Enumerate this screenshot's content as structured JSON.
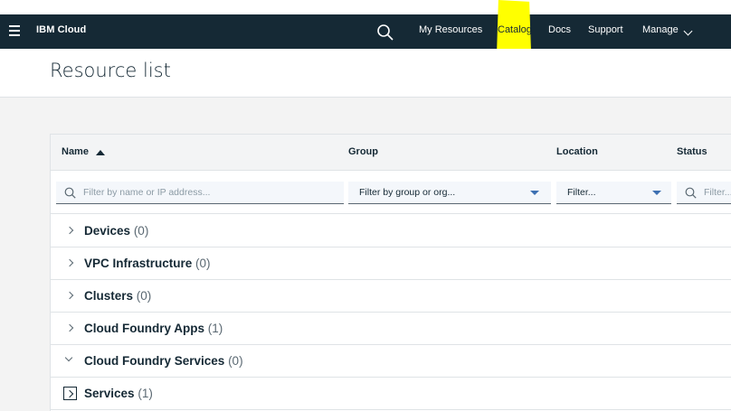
{
  "navbar": {
    "brand": "IBM Cloud",
    "links": {
      "my_resources": "My Resources",
      "catalog": "Catalog",
      "docs": "Docs",
      "support": "Support",
      "manage": "Manage"
    },
    "highlight_color": "#ffff00",
    "background": "#152935"
  },
  "header": {
    "title": "Resource list"
  },
  "table": {
    "columns": {
      "name": "Name",
      "group": "Group",
      "location": "Location",
      "status": "Status"
    },
    "sort": {
      "column": "Name",
      "direction": "ascending"
    },
    "filters": {
      "name_placeholder": "Filter by name or IP address...",
      "group_value": "Filter by group or org...",
      "location_value": "Filter...",
      "status_placeholder": "Filter..."
    },
    "rows": [
      {
        "label": "Devices",
        "count": "(0)",
        "state": "collapsed"
      },
      {
        "label": "VPC Infrastructure",
        "count": "(0)",
        "state": "collapsed"
      },
      {
        "label": "Clusters",
        "count": "(0)",
        "state": "collapsed"
      },
      {
        "label": "Cloud Foundry Apps",
        "count": "(1)",
        "state": "collapsed"
      },
      {
        "label": "Cloud Foundry Services",
        "count": "(0)",
        "state": "expanded"
      },
      {
        "label": "Services",
        "count": "(1)",
        "state": "collapsed-focused"
      }
    ]
  }
}
